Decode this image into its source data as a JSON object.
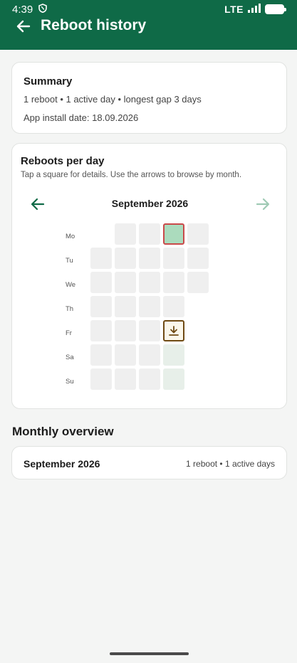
{
  "status_bar": {
    "time": "4:39",
    "network": "LTE"
  },
  "header": {
    "title": "Reboot history"
  },
  "summary": {
    "title": "Summary",
    "stats": "1 reboot • 1 active day • longest gap 3 days",
    "install_date": "App install date: 18.09.2026"
  },
  "chart": {
    "title": "Reboots per day",
    "hint": "Tap a square for details. Use the arrows to browse by month.",
    "month": "September 2026",
    "day_labels": [
      "Mo",
      "Tu",
      "We",
      "Th",
      "Fr",
      "Sa",
      "Su"
    ]
  },
  "chart_data": {
    "type": "heatmap",
    "title": "Reboots per day",
    "month": "September 2026",
    "rows": [
      "Mo",
      "Tu",
      "We",
      "Th",
      "Fr",
      "Sa",
      "Su"
    ],
    "weeks": 5,
    "reboots_by_date": {
      "21": 1
    },
    "highlighted_date": "21",
    "today_date": "25",
    "days_after_today": [
      "26",
      "27"
    ]
  },
  "overview": {
    "heading": "Monthly overview",
    "months": [
      {
        "label": "September 2026",
        "stats": "1 reboot • 1 active days"
      }
    ]
  },
  "colors": {
    "app_bar": "#0f6a47",
    "cell_empty": "#efefef",
    "cell_active": "#abdbbd",
    "cell_highlight_border": "#c94a4a",
    "today_border": "#6f4a14"
  }
}
